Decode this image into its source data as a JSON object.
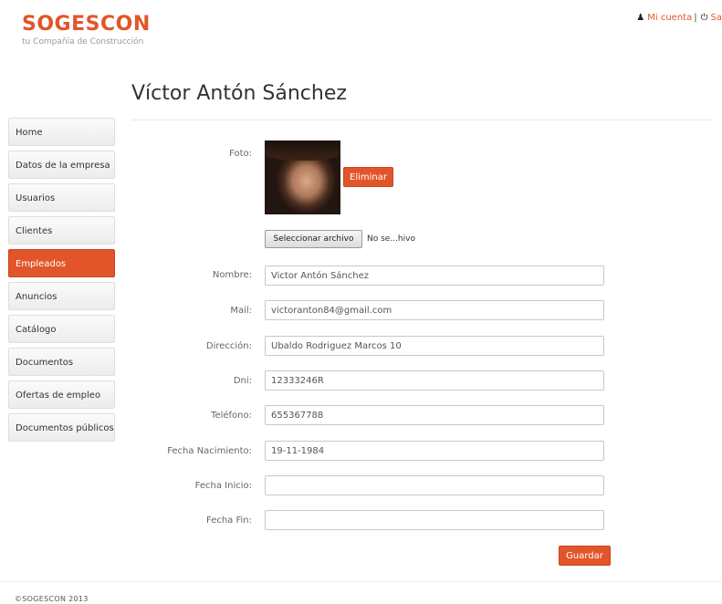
{
  "brand": {
    "name": "SOGESCON",
    "tagline": "tu Compañía de Construcción"
  },
  "topbar": {
    "account_icon": "user-icon",
    "account_label": "Mi cuenta",
    "logout_icon": "power-icon",
    "logout_label": "Sa"
  },
  "page": {
    "title": "Víctor Antón Sánchez"
  },
  "sidebar": {
    "items": [
      {
        "label": "Home"
      },
      {
        "label": "Datos de la empresa"
      },
      {
        "label": "Usuarios"
      },
      {
        "label": "Clientes"
      },
      {
        "label": "Empleados",
        "active": true
      },
      {
        "label": "Anuncios"
      },
      {
        "label": "Catálogo"
      },
      {
        "label": "Documentos"
      },
      {
        "label": "Ofertas de empleo"
      },
      {
        "label": "Documentos públicos"
      }
    ]
  },
  "form": {
    "photo_label": "Foto:",
    "delete_button": "Eliminar",
    "file_button": "Seleccionar archivo",
    "file_status": "No se...hivo",
    "nombre": {
      "label": "Nombre:",
      "value": "Victor Antón Sánchez"
    },
    "mail": {
      "label": "Mail:",
      "value": "victoranton84@gmail.com"
    },
    "direccion": {
      "label": "Dirección:",
      "value": "Ubaldo Rodriguez Marcos 10"
    },
    "dni": {
      "label": "Dni:",
      "value": "12333246R"
    },
    "telefono": {
      "label": "Teléfono:",
      "value": "655367788"
    },
    "fecha_nacimiento": {
      "label": "Fecha Nacimiento:",
      "value": "19-11-1984"
    },
    "fecha_inicio": {
      "label": "Fecha Inicio:",
      "value": ""
    },
    "fecha_fin": {
      "label": "Fecha Fin:",
      "value": ""
    },
    "save_button": "Guardar"
  },
  "footer": {
    "text": "©SOGESCON 2013"
  },
  "colors": {
    "accent": "#e2552a"
  }
}
